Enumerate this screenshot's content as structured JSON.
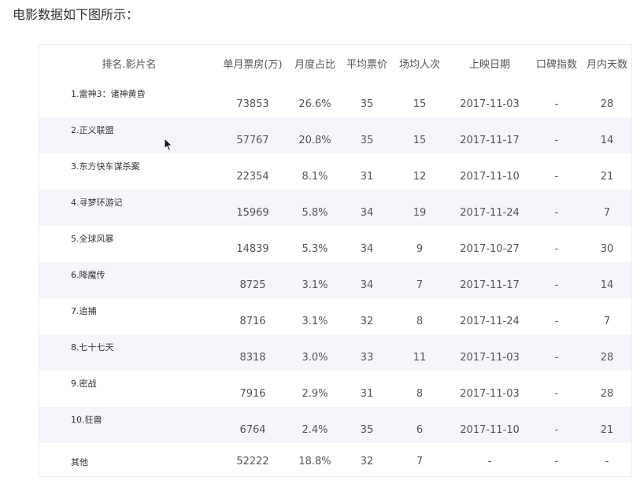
{
  "intro_text": "电影数据如下图所示：",
  "table": {
    "headers": [
      "排名.影片名",
      "单月票房(万)",
      "月度占比",
      "平均票价",
      "场均人次",
      "上映日期",
      "口碑指数",
      "月内天数"
    ],
    "rows": [
      [
        "1.雷神3：诸神黄昏",
        "73853",
        "26.6%",
        "35",
        "15",
        "2017-11-03",
        "-",
        "28"
      ],
      [
        "2.正义联盟",
        "57767",
        "20.8%",
        "35",
        "15",
        "2017-11-17",
        "-",
        "14"
      ],
      [
        "3.东方快车谋杀案",
        "22354",
        "8.1%",
        "31",
        "12",
        "2017-11-10",
        "-",
        "21"
      ],
      [
        "4.寻梦环游记",
        "15969",
        "5.8%",
        "34",
        "19",
        "2017-11-24",
        "-",
        "7"
      ],
      [
        "5.全球风暴",
        "14839",
        "5.3%",
        "34",
        "9",
        "2017-10-27",
        "-",
        "30"
      ],
      [
        "6.降魔传",
        "8725",
        "3.1%",
        "34",
        "7",
        "2017-11-17",
        "-",
        "14"
      ],
      [
        "7.追捕",
        "8716",
        "3.1%",
        "32",
        "8",
        "2017-11-24",
        "-",
        "7"
      ],
      [
        "8.七十七天",
        "8318",
        "3.0%",
        "33",
        "11",
        "2017-11-03",
        "-",
        "28"
      ],
      [
        "9.密战",
        "7916",
        "2.9%",
        "31",
        "8",
        "2017-11-03",
        "-",
        "28"
      ],
      [
        "10.狂兽",
        "6764",
        "2.4%",
        "35",
        "6",
        "2017-11-10",
        "-",
        "21"
      ],
      [
        "其他",
        "52222",
        "18.8%",
        "32",
        "7",
        "-",
        "-",
        "-"
      ]
    ]
  },
  "colors": {
    "row_alt": "#f6f5fb",
    "text": "#555555"
  }
}
